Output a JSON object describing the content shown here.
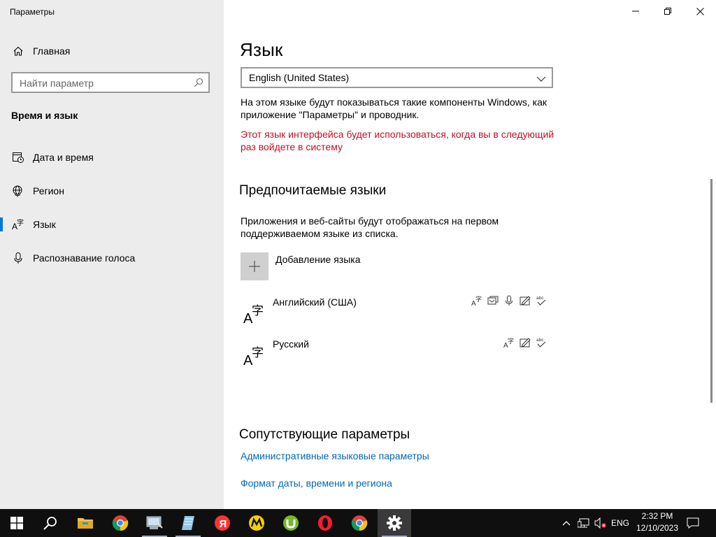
{
  "window": {
    "title": "Параметры"
  },
  "sidebar": {
    "home_label": "Главная",
    "search_placeholder": "Найти параметр",
    "section_title": "Время и язык",
    "items": [
      {
        "label": "Дата и время",
        "icon": "date-time-icon"
      },
      {
        "label": "Регион",
        "icon": "globe-icon"
      },
      {
        "label": "Язык",
        "icon": "language-icon",
        "active": true
      },
      {
        "label": "Распознавание голоса",
        "icon": "microphone-icon"
      }
    ]
  },
  "main": {
    "title": "Язык",
    "display_language": {
      "selected": "English (United States)"
    },
    "display_note_line1": "На этом языке будут показываться такие компоненты Windows, как",
    "display_note_line2": "приложение \"Параметры\" и проводник.",
    "warning_line1": "Этот язык интерфейса будет использоваться, когда вы в следующий",
    "warning_line2": "раз войдете в систему",
    "preferred": {
      "heading": "Предпочитаемые языки",
      "desc_line1": "Приложения и веб-сайты будут отображаться на первом",
      "desc_line2": "поддерживаемом языке из списка.",
      "add_label": "Добавление языка",
      "languages": [
        {
          "name": "Английский (США)",
          "features": [
            "display-language",
            "text-to-speech",
            "speech",
            "handwriting",
            "spell-check"
          ]
        },
        {
          "name": "Русский",
          "features": [
            "display-language",
            "handwriting",
            "spell-check"
          ]
        }
      ]
    },
    "related": {
      "heading": "Сопутствующие параметры",
      "links": [
        "Административные языковые параметры",
        "Формат даты, времени и региона"
      ]
    }
  },
  "taskbar": {
    "apps": [
      "start",
      "search",
      "file-explorer",
      "chrome",
      "control-panel",
      "notepad",
      "yandex-browser",
      "unknown-app",
      "utorrent",
      "opera",
      "chrome-2",
      "settings"
    ],
    "tray": {
      "language": "ENG",
      "time": "2:32 PM",
      "date": "12/10/2023"
    }
  },
  "colors": {
    "accent": "#0078d7",
    "link": "#0067b8",
    "warning": "#c50f1f",
    "sidebar_bg": "#ececec",
    "taskbar_bg": "#0f0f0f"
  }
}
